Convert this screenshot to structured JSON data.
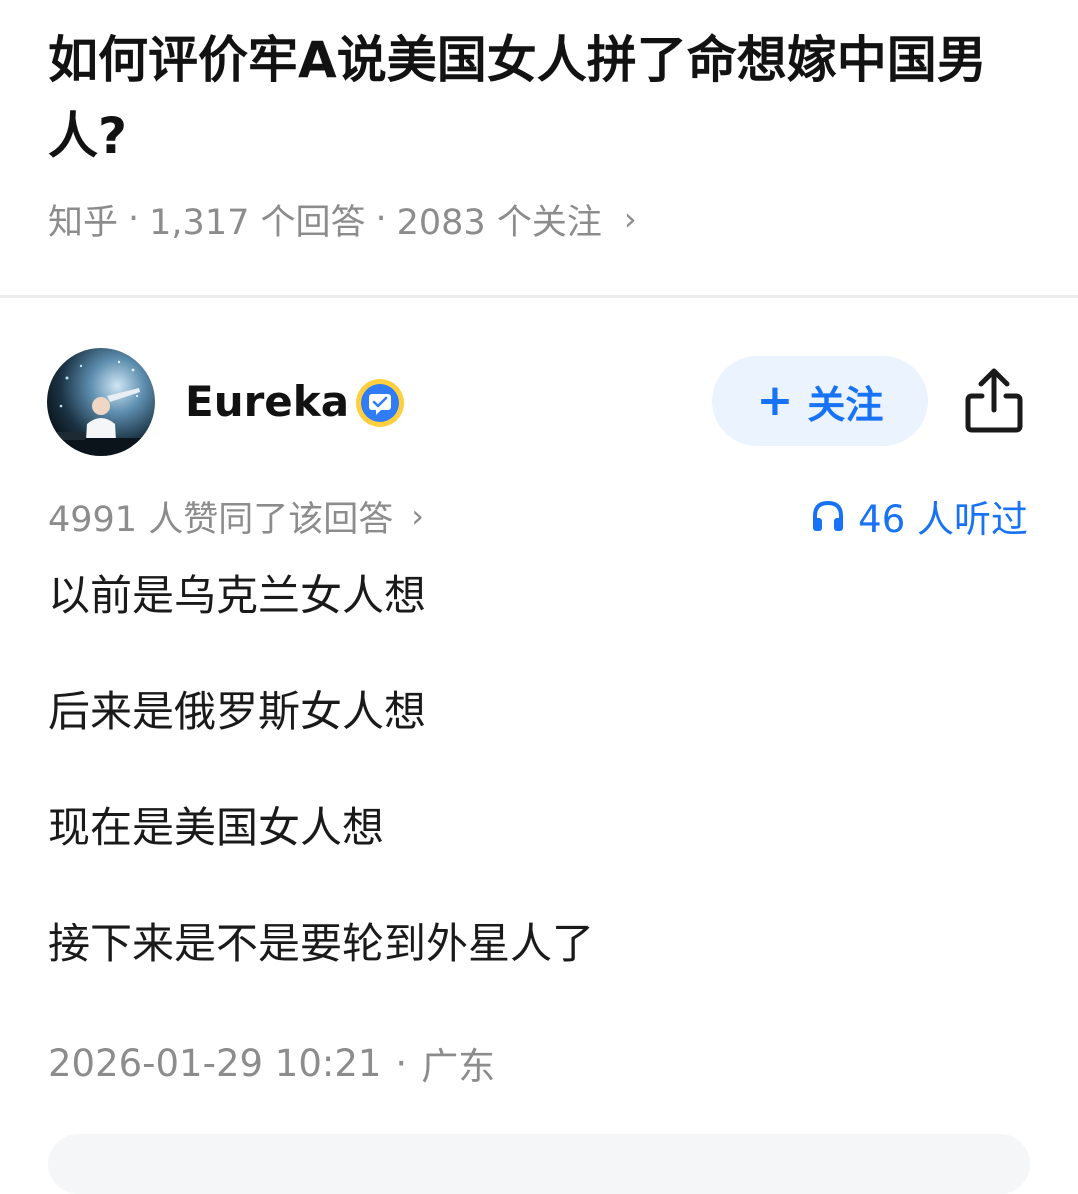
{
  "question": {
    "title": "如何评价牢A说美国女人拼了命想嫁中国男人?",
    "source": "知乎",
    "answers_count": "1,317 个回答",
    "followers_count": "2083 个关注",
    "separator": "·",
    "chevron": "›"
  },
  "answer": {
    "author": {
      "name": "Eureka",
      "follow_label": "关注",
      "follow_plus": "+"
    },
    "upvotes_text": "4991 人赞同了该回答",
    "upvotes_chevron": "›",
    "listened_text": "46 人听过",
    "content": [
      "以前是乌克兰女人想",
      "后来是俄罗斯女人想",
      "现在是美国女人想",
      "接下来是不是要轮到外星人了"
    ],
    "timestamp": "2026-01-29 10:21",
    "timestamp_separator": "·",
    "location": "广东"
  },
  "colors": {
    "accent": "#1772f6",
    "follow_bg": "#ebf3ff",
    "muted_text": "#8c8c8c",
    "divider": "#ececec"
  },
  "icons": {
    "verified": "verified-badge-icon",
    "share": "share-icon",
    "headphones": "headphones-icon",
    "chevron": "chevron-right-icon"
  }
}
